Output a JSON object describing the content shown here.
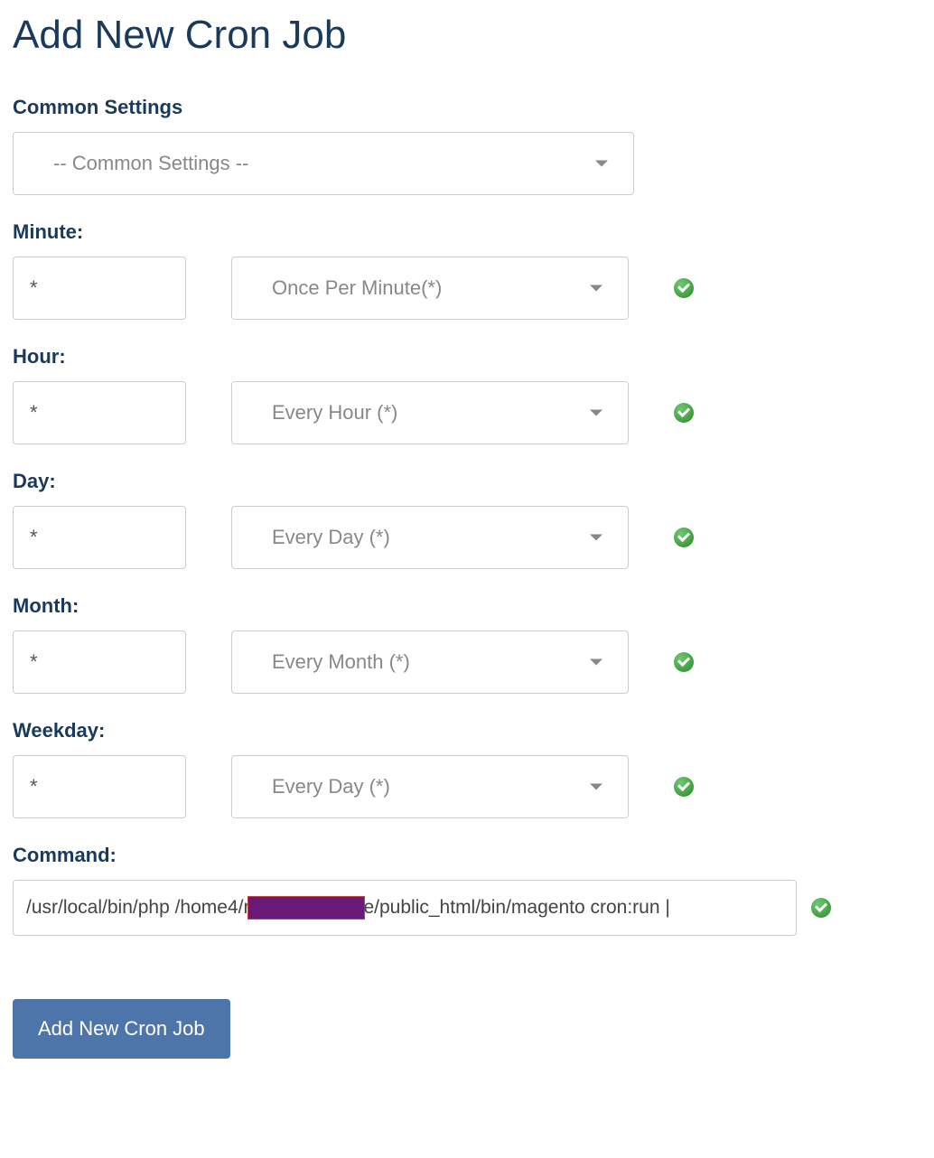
{
  "page_title": "Add New Cron Job",
  "common_settings": {
    "label": "Common Settings",
    "selected": "-- Common Settings --"
  },
  "minute": {
    "label": "Minute:",
    "value": "*",
    "preset": "Once Per Minute(*)"
  },
  "hour": {
    "label": "Hour:",
    "value": "*",
    "preset": "Every Hour (*)"
  },
  "day": {
    "label": "Day:",
    "value": "*",
    "preset": "Every Day (*)"
  },
  "month": {
    "label": "Month:",
    "value": "*",
    "preset": "Every Month (*)"
  },
  "weekday": {
    "label": "Weekday:",
    "value": "*",
    "preset": "Every Day (*)"
  },
  "command": {
    "label": "Command:",
    "value_prefix": "/usr/local/bin/php /home4/",
    "value_redacted_left": "r",
    "value_redacted_right": "e",
    "value_suffix": "/public_html/bin/magento cron:run | "
  },
  "submit_label": "Add New Cron Job"
}
